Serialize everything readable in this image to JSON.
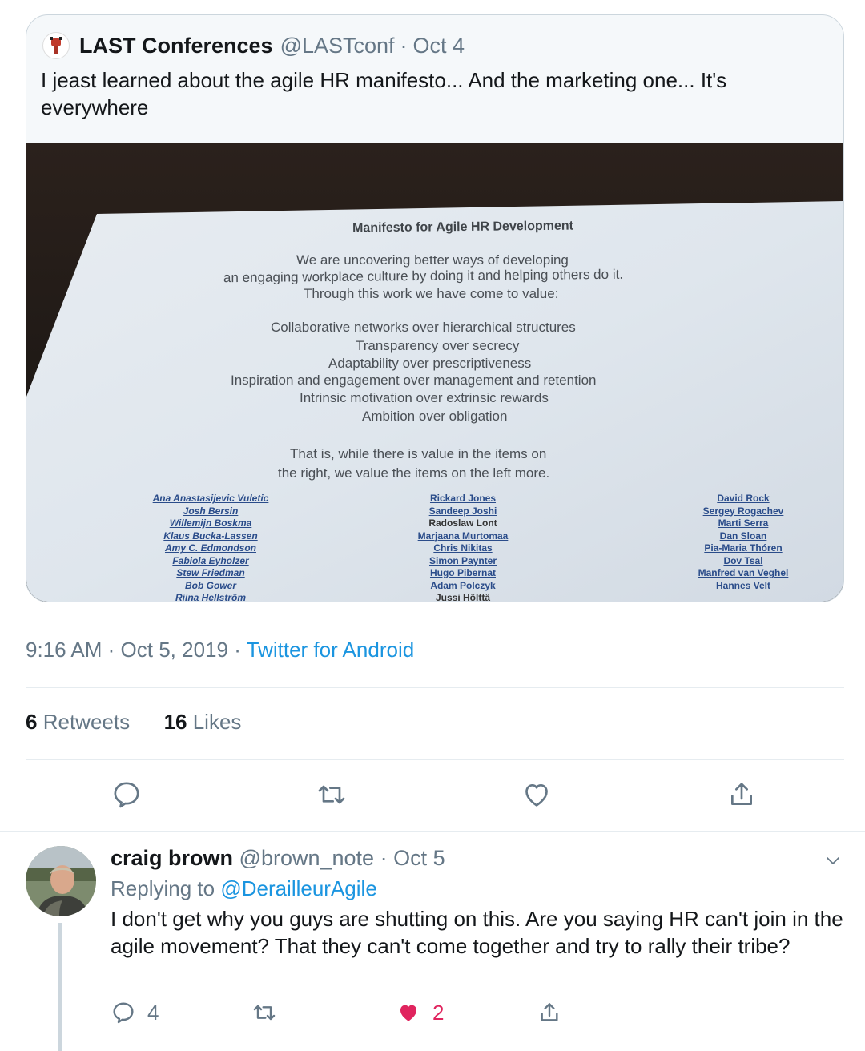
{
  "quoted_tweet": {
    "name": "LAST Conferences",
    "handle": "@LASTconf",
    "date": "Oct 4",
    "separator": "·",
    "text": "I jeast learned about the agile HR manifesto... And the marketing one... It's everywhere",
    "photo": {
      "title": "Manifesto for Agile HR Development",
      "intro": [
        "We are uncovering better ways of developing",
        "an engaging workplace culture by doing it and helping others do it.",
        "Through this work we have come to value:"
      ],
      "values": [
        "Collaborative networks over hierarchical structures",
        "Transparency over secrecy",
        "Adaptability over prescriptiveness",
        "Inspiration and engagement over management and retention",
        "Intrinsic motivation over extrinsic rewards",
        "Ambition over obligation"
      ],
      "closing": [
        "That is, while there is value in the items on",
        "the right, we value the items on the left more."
      ],
      "signatories_left": [
        "Ana Anastasijevic Vuletic",
        "Josh Bersin",
        "Willemijn Boskma",
        "Klaus Bucka-Lassen",
        "Amy C. Edmondson",
        "Fabiola Eyholzer",
        "Stew Friedman",
        "Bob Gower",
        "Riina Hellström"
      ],
      "signatories_middle": [
        "Rickard Jones",
        "Sandeep Joshi",
        "Radoslaw Lont",
        "Marjaana Murtomaa",
        "Chris Nikitas",
        "Simon Paynter",
        "Hugo Pibernat",
        "Adam Polczyk",
        "Jussi Hölttä"
      ],
      "signatories_right": [
        "David Rock",
        "Sergey Rogachev",
        "Marti Serra",
        "Dan Sloan",
        "Pia-Maria Thóren",
        "Dov Tsal",
        "Manfred van Veghel",
        "Hannes Velt"
      ]
    }
  },
  "tweet_meta": {
    "time": "9:16 AM",
    "date": "Oct 5, 2019",
    "separator": "·",
    "client": "Twitter for Android"
  },
  "stats": {
    "retweets_count": "6",
    "retweets_label": "Retweets",
    "likes_count": "16",
    "likes_label": "Likes"
  },
  "icons": {
    "reply": "reply-icon",
    "retweet": "retweet-icon",
    "like": "heart-icon",
    "share": "share-icon",
    "more": "chevron-down-icon"
  },
  "reply_tweet": {
    "name": "craig brown",
    "handle": "@brown_note",
    "separator": "·",
    "date": "Oct 5",
    "replying_prefix": "Replying to",
    "replying_to": "@DerailleurAgile",
    "text": "I don't get why you guys are shutting on this. Are you saying HR can't join in the agile movement? That they can't come together and try to rally their tribe?",
    "reply_count": "4",
    "like_count": "2"
  },
  "colors": {
    "accent": "#1b95e0",
    "muted": "#657786",
    "like": "#e0245e",
    "border": "#ccd6dd"
  }
}
